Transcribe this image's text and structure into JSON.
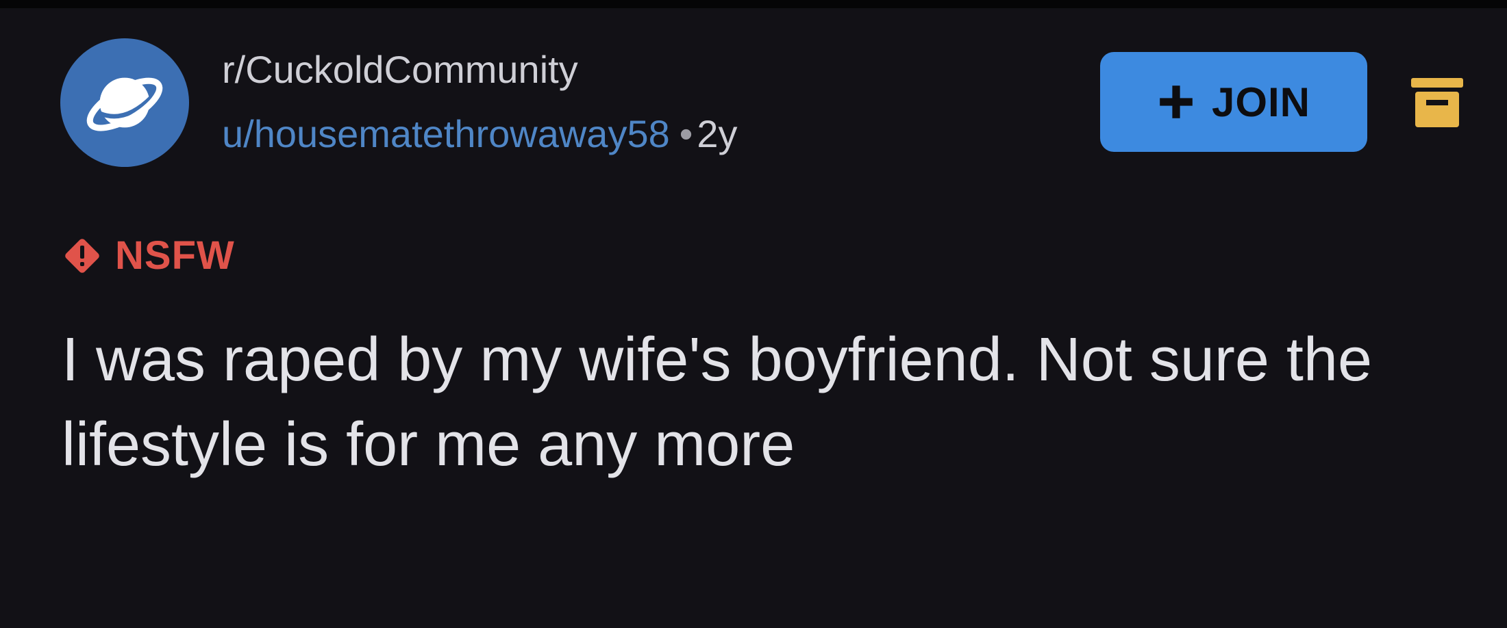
{
  "post": {
    "subreddit": "r/CuckoldCommunity",
    "author": "u/housematethrowaway58",
    "separator": "•",
    "age": "2y",
    "join_label": "JOIN",
    "nsfw_label": "NSFW",
    "title": "I was raped by my wife's boyfriend. Not sure the lifestyle is for me any more"
  },
  "icons": {
    "avatar": "planet-icon",
    "join": "plus-icon",
    "nsfw": "warning-diamond-icon",
    "mod": "mod-shield-icon"
  },
  "colors": {
    "background": "#121116",
    "join_button": "#3d8ae0",
    "username": "#4f86c6",
    "nsfw": "#e0534a",
    "avatar": "#3c6fb3",
    "mod_icon": "#e8b64a"
  }
}
